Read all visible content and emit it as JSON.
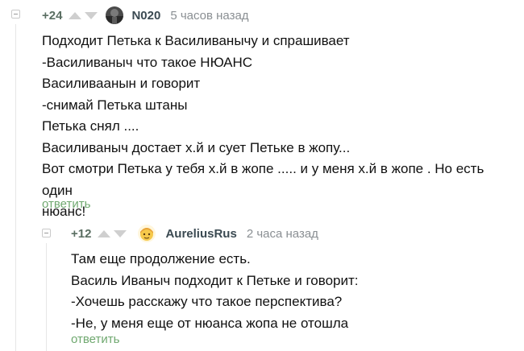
{
  "comments": [
    {
      "rating": "+24",
      "username": "N020",
      "time": "5 часов назад",
      "lines": [
        "Подходит Петька к Василиванычу и спрашивает",
        "-Василиваныч что такое НЮАНС",
        "Василиваанын и говорит",
        "-снимай Петька штаны",
        "Петька снял ....",
        "Василиваныч достает х.й и сует Петьке в жопу...",
        "Вот смотри Петька у тебя х.й в жопе ..... и у меня х.й в жопе . Но есть один",
        "нюанс!"
      ],
      "reply_label": "ответить"
    },
    {
      "rating": "+12",
      "username": "AureliusRus",
      "time": "2 часа назад",
      "lines": [
        "Там еще продолжение есть.",
        "Василь Иваныч подходит к Петьке и говорит:",
        "-Хочешь расскажу что такое перспектива?",
        "-Не, у меня еще от нюанса жопа не отошла"
      ],
      "reply_label": "ответить"
    }
  ],
  "icons": {
    "collapse": "collapse-icon",
    "upvote": "arrow-up-icon",
    "downvote": "arrow-down-icon"
  },
  "colors": {
    "reply": "#6fa86f",
    "rating": "#5a6e62",
    "arrows": "#cfcfcf"
  }
}
